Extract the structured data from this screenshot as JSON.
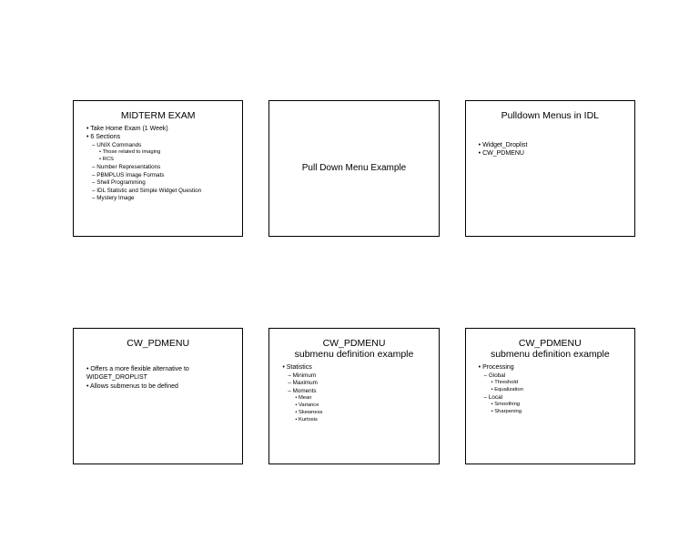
{
  "slides": {
    "s1": {
      "title": "MIDTERM EXAM",
      "b1": "Take Home Exam (1 Week)",
      "b2": "6 Sections",
      "s1": "UNIX Commands",
      "s1a": "Those related to imaging",
      "s1b": "RCS",
      "s2": "Number Representations",
      "s3": "PBMPLUS Image Formats",
      "s4": "Shell Programming",
      "s5": "IDL Statistic and Simple Widget Question",
      "s6": "Mystery Image"
    },
    "s2": {
      "title": "Pull Down Menu Example"
    },
    "s3": {
      "title": "Pulldown Menus in IDL",
      "b1": "Widget_Droplist",
      "b2": "CW_PDMENU"
    },
    "s4": {
      "title": "CW_PDMENU",
      "b1": "Offers a more flexible alternative to WIDGET_DROPLIST",
      "b2": "Allows submenus to be defined"
    },
    "s5": {
      "titleA": "CW_PDMENU",
      "titleB": "submenu definition example",
      "b1": "Statistics",
      "s1": "Minimum",
      "s2": "Maximum",
      "s3": "Moments",
      "t1": "Mean",
      "t2": "Variance",
      "t3": "Skewness",
      "t4": "Kurtosis"
    },
    "s6": {
      "titleA": "CW_PDMENU",
      "titleB": "submenu definition example",
      "b1": "Processing",
      "s1": "Global",
      "t1": "Threshold",
      "t2": "Equalization",
      "s2": "Local",
      "t3": "Smoothing",
      "t4": "Sharpening"
    }
  }
}
